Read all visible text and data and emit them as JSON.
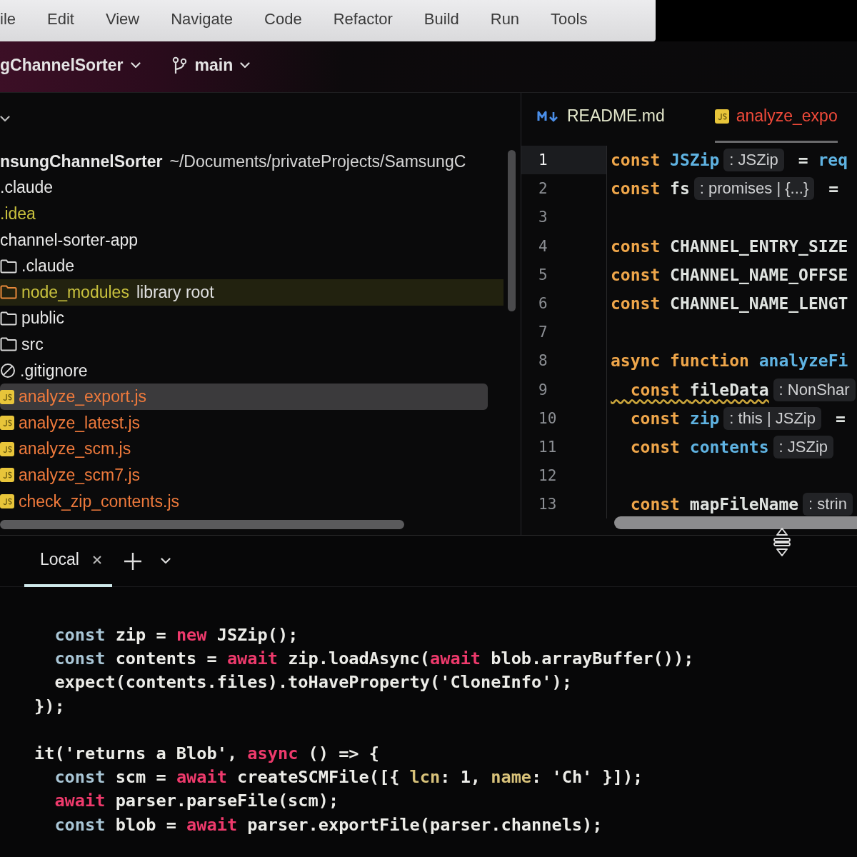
{
  "menu_bar": {
    "items": [
      "ile",
      "Edit",
      "View",
      "Navigate",
      "Code",
      "Refactor",
      "Build",
      "Run",
      "Tools"
    ]
  },
  "toolbar": {
    "project": "gChannelSorter",
    "branch": "main"
  },
  "project_panel": {
    "tree": [
      {
        "label": "nsungChannelSorter",
        "path": "~/Documents/privateProjects/SamsungC",
        "color": "#e8e8e8",
        "selected": false,
        "children": [
          {
            "label": ".claude",
            "color": "#e8e8e8",
            "selected": false
          },
          {
            "label": ".idea",
            "color": "#c9c23e",
            "selected": false
          },
          {
            "label": "channel-sorter-app",
            "color": "#e8e8e8",
            "selected": false,
            "children": [
              {
                "label": ".claude",
                "kind": "folder",
                "color": "#e8e8e8",
                "selected": false
              },
              {
                "label": "node_modules",
                "note": "library root",
                "kind": "library-folder",
                "color": "#c9c23e",
                "selected": false
              },
              {
                "label": "public",
                "kind": "folder",
                "color": "#e8e8e8",
                "selected": false
              },
              {
                "label": "src",
                "kind": "folder",
                "color": "#e8e8e8",
                "selected": false
              },
              {
                "label": ".gitignore",
                "kind": "ignore-file",
                "color": "#e8e8e8",
                "selected": false
              },
              {
                "label": "analyze_export.js",
                "kind": "js",
                "color": "#ef7a3c",
                "selected": true
              },
              {
                "label": "analyze_latest.js",
                "kind": "js",
                "color": "#ef7a3c",
                "selected": false
              },
              {
                "label": "analyze_scm.js",
                "kind": "js",
                "color": "#ef7a3c",
                "selected": false
              },
              {
                "label": "analyze_scm7.js",
                "kind": "js",
                "color": "#ef7a3c",
                "selected": false
              },
              {
                "label": "check_zip_contents.js",
                "kind": "js",
                "color": "#ef7a3c",
                "selected": false
              }
            ]
          }
        ]
      }
    ]
  },
  "editor": {
    "tabs": [
      {
        "label": "README.md",
        "kind": "markdown",
        "color": "#e4e8cc",
        "selected": false
      },
      {
        "label": "analyze_expo",
        "kind": "js",
        "color": "#f04a3a",
        "selected": true
      }
    ],
    "lines": [
      {
        "number": "1",
        "current": true,
        "segments": [
          {
            "kind": "code",
            "tokens": [
              {
                "text": "const ",
                "kind": "keyword"
              },
              {
                "text": "JSZip",
                "kind": "identifier"
              }
            ]
          },
          {
            "kind": "hint",
            "text": ": JSZip"
          },
          {
            "kind": "code",
            "tokens": [
              {
                "text": "= ",
                "kind": "plain"
              },
              {
                "text": "req",
                "kind": "identifier"
              }
            ]
          }
        ]
      },
      {
        "number": "2",
        "current": false,
        "segments": [
          {
            "kind": "code",
            "tokens": [
              {
                "text": "const ",
                "kind": "keyword"
              },
              {
                "text": "fs",
                "kind": "plain"
              }
            ]
          },
          {
            "kind": "hint",
            "text": ": promises | {...}"
          },
          {
            "kind": "code",
            "tokens": [
              {
                "text": "=",
                "kind": "plain"
              }
            ]
          }
        ]
      },
      {
        "number": "3",
        "current": false
      },
      {
        "number": "4",
        "current": false,
        "segments": [
          {
            "kind": "code",
            "tokens": [
              {
                "text": "const ",
                "kind": "keyword"
              },
              {
                "text": "CHANNEL_ENTRY_SIZE",
                "kind": "plain"
              }
            ]
          }
        ]
      },
      {
        "number": "5",
        "current": false,
        "segments": [
          {
            "kind": "code",
            "tokens": [
              {
                "text": "const ",
                "kind": "keyword"
              },
              {
                "text": "CHANNEL_NAME_OFFSE",
                "kind": "plain"
              }
            ]
          }
        ]
      },
      {
        "number": "6",
        "current": false,
        "segments": [
          {
            "kind": "code",
            "tokens": [
              {
                "text": "const ",
                "kind": "keyword"
              },
              {
                "text": "CHANNEL_NAME_LENGT",
                "kind": "plain"
              }
            ]
          }
        ]
      },
      {
        "number": "7",
        "current": false
      },
      {
        "number": "8",
        "current": false,
        "segments": [
          {
            "kind": "code",
            "tokens": [
              {
                "text": "async function ",
                "kind": "keyword"
              },
              {
                "text": "analyzeFi",
                "kind": "identifier"
              }
            ]
          }
        ]
      },
      {
        "number": "9",
        "current": false,
        "segments": [
          {
            "kind": "warning-code",
            "tokens": [
              {
                "text": "  const ",
                "kind": "keyword"
              },
              {
                "text": "fileData",
                "kind": "plain"
              }
            ]
          },
          {
            "kind": "hint",
            "text": ": NonShar"
          }
        ]
      },
      {
        "number": "10",
        "current": false,
        "segments": [
          {
            "kind": "code",
            "tokens": [
              {
                "text": "  const ",
                "kind": "keyword"
              },
              {
                "text": "zip",
                "kind": "identifier"
              }
            ]
          },
          {
            "kind": "hint",
            "text": ": this | JSZip"
          },
          {
            "kind": "code",
            "tokens": [
              {
                "text": "=",
                "kind": "plain"
              }
            ]
          }
        ]
      },
      {
        "number": "11",
        "current": false,
        "segments": [
          {
            "kind": "code",
            "tokens": [
              {
                "text": "  const ",
                "kind": "keyword"
              },
              {
                "text": "contents",
                "kind": "identifier"
              }
            ]
          },
          {
            "kind": "hint",
            "text": ": JSZip"
          }
        ]
      },
      {
        "number": "12",
        "current": false
      },
      {
        "number": "13",
        "current": false,
        "segments": [
          {
            "kind": "code",
            "tokens": [
              {
                "text": "  const ",
                "kind": "keyword"
              },
              {
                "text": "mapFileName",
                "kind": "plain"
              }
            ]
          },
          {
            "kind": "hint",
            "text": ": strin"
          }
        ]
      }
    ]
  },
  "terminal": {
    "tabs": [
      {
        "label": "Local",
        "selected": true
      }
    ],
    "lines": [
      {
        "kind": "code",
        "tokens": [
          {
            "text": "  const ",
            "kind": "keyword"
          },
          {
            "text": "zip = ",
            "kind": "plain"
          },
          {
            "text": "new ",
            "kind": "operator-keyword"
          },
          {
            "text": "JSZip();",
            "kind": "plain"
          }
        ]
      },
      {
        "kind": "code",
        "tokens": [
          {
            "text": "  const ",
            "kind": "keyword"
          },
          {
            "text": "contents = ",
            "kind": "plain"
          },
          {
            "text": "await ",
            "kind": "operator-keyword"
          },
          {
            "text": "zip.loadAsync(",
            "kind": "plain"
          },
          {
            "text": "await ",
            "kind": "operator-keyword"
          },
          {
            "text": "blob.arrayBuffer());",
            "kind": "plain"
          }
        ]
      },
      {
        "kind": "code",
        "tokens": [
          {
            "text": "  expect(contents.files).toHaveProperty('CloneInfo');",
            "kind": "plain"
          }
        ]
      },
      {
        "kind": "code",
        "tokens": [
          {
            "text": "});",
            "kind": "plain"
          }
        ]
      },
      {
        "kind": "blank"
      },
      {
        "kind": "code",
        "tokens": [
          {
            "text": "it('returns a Blob', ",
            "kind": "plain"
          },
          {
            "text": "async ",
            "kind": "operator-keyword"
          },
          {
            "text": "() => {",
            "kind": "plain"
          }
        ]
      },
      {
        "kind": "code",
        "tokens": [
          {
            "text": "  const ",
            "kind": "keyword"
          },
          {
            "text": "scm = ",
            "kind": "plain"
          },
          {
            "text": "await ",
            "kind": "operator-keyword"
          },
          {
            "text": "createSCMFile([{ ",
            "kind": "plain"
          },
          {
            "text": "lcn",
            "kind": "property"
          },
          {
            "text": ": 1, ",
            "kind": "plain"
          },
          {
            "text": "name",
            "kind": "property"
          },
          {
            "text": ": 'Ch' }]);",
            "kind": "plain"
          }
        ]
      },
      {
        "kind": "code",
        "tokens": [
          {
            "text": "  await ",
            "kind": "operator-keyword"
          },
          {
            "text": "parser.parseFile(scm);",
            "kind": "plain"
          }
        ]
      },
      {
        "kind": "code",
        "tokens": [
          {
            "text": "  const ",
            "kind": "keyword"
          },
          {
            "text": "blob = ",
            "kind": "plain"
          },
          {
            "text": "await ",
            "kind": "operator-keyword"
          },
          {
            "text": "parser.exportFile(parser.channels);",
            "kind": "plain"
          }
        ]
      }
    ]
  }
}
